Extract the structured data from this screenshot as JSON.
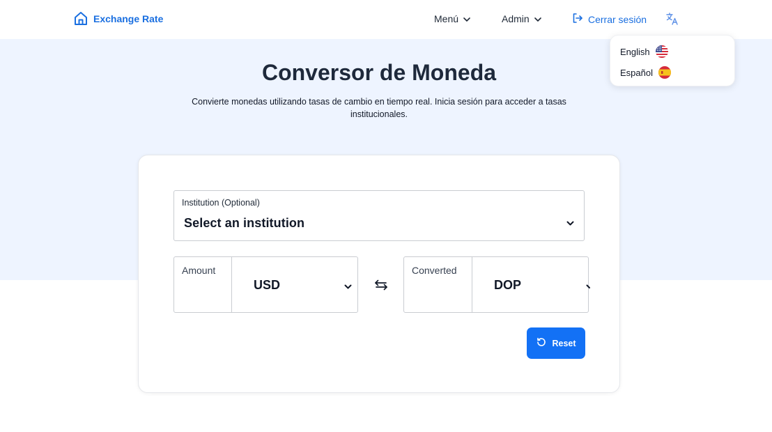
{
  "header": {
    "brand": "Exchange Rate",
    "menu_label": "Menú",
    "admin_label": "Admin",
    "logout_label": "Cerrar sesión",
    "icons": {
      "brand": "home-icon",
      "menu_chevron": "chevron-down-icon",
      "logout": "logout-icon",
      "language": "translate-icon"
    }
  },
  "language_menu": {
    "options": [
      {
        "label": "English",
        "flag": "us-flag-icon"
      },
      {
        "label": "Español",
        "flag": "spain-flag-icon"
      }
    ]
  },
  "hero": {
    "title": "Conversor de Moneda",
    "subtitle": "Convierte monedas utilizando tasas de cambio en tiempo real. Inicia sesión para acceder a tasas institucionales."
  },
  "converter": {
    "institution": {
      "label": "Institution (Optional)",
      "value": "Select an institution"
    },
    "from": {
      "label": "Amount",
      "value": "",
      "currency": "USD"
    },
    "to": {
      "label": "Converted",
      "value": "",
      "currency": "DOP"
    },
    "swap_icon": "swap-arrows-icon",
    "reset_label": "Reset",
    "reset_icon": "reset-icon"
  },
  "colors": {
    "accent": "#1a6fe0",
    "button": "#1371f5",
    "hero_bg": "#eef4ff"
  }
}
